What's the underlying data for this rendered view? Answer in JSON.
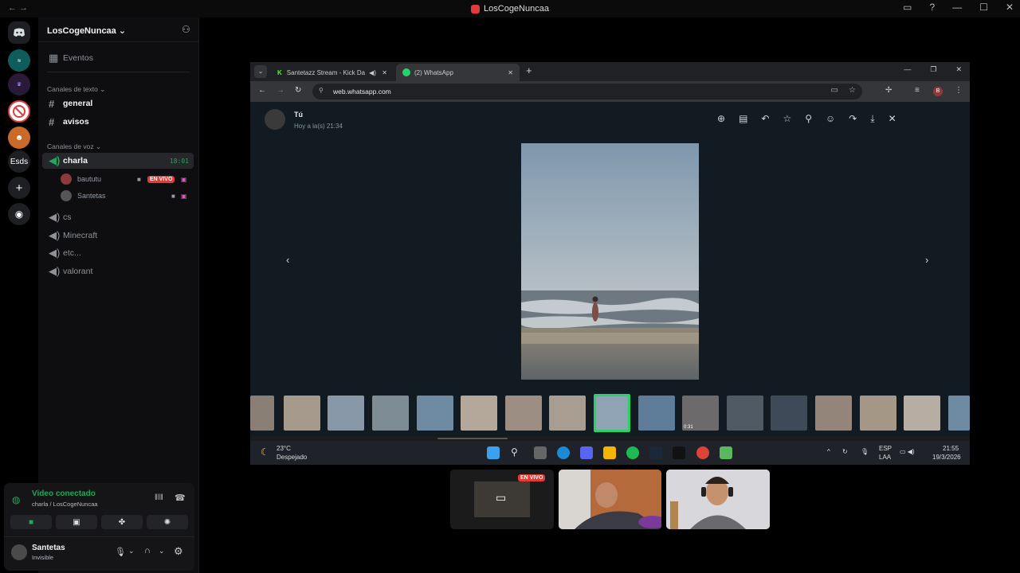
{
  "window": {
    "title": "LosCogeNuncaa"
  },
  "rail": {
    "servers": [
      "Esds"
    ]
  },
  "sidebar": {
    "server_name": "LosCogeNuncaa",
    "events_label": "Eventos",
    "text_category": "Canales de texto",
    "text_channels": [
      "general",
      "avisos"
    ],
    "voice_category": "Canales de voz",
    "active_voice": {
      "name": "charla",
      "time": "18:01"
    },
    "voice_users": [
      {
        "name": "baututu",
        "badge": "EN VIVO"
      },
      {
        "name": "Santetas"
      }
    ],
    "other_voice": [
      "cs",
      "Minecraft",
      "etc...",
      "valorant"
    ]
  },
  "voice_panel": {
    "status": "Video conectado",
    "location": "charla / LosCogeNuncaa",
    "user_name": "Santetas",
    "user_status": "Invisible"
  },
  "browser": {
    "tabs": [
      {
        "label": "Santetazz Stream - Kick Da",
        "active": false
      },
      {
        "label": "(2) WhatsApp",
        "active": true
      }
    ],
    "url": "web.whatsapp.com",
    "profile_initial": "B"
  },
  "whatsapp_viewer": {
    "sender": "Tú",
    "timestamp": "Hoy a la(s) 21:34"
  },
  "taskbar": {
    "weather_temp": "23°C",
    "weather_desc": "Despejado",
    "lang": "ESP",
    "layout": "LAA",
    "time": "21:55",
    "date": "19/3/2026",
    "video_duration": "0:31"
  },
  "stream_preview": {
    "badge": "EN VIVO"
  },
  "colors": {
    "accent_green": "#23a55a",
    "live_red": "#e53935",
    "whatsapp_bg": "#111b21",
    "sidebar_bg": "#0e0e10"
  }
}
